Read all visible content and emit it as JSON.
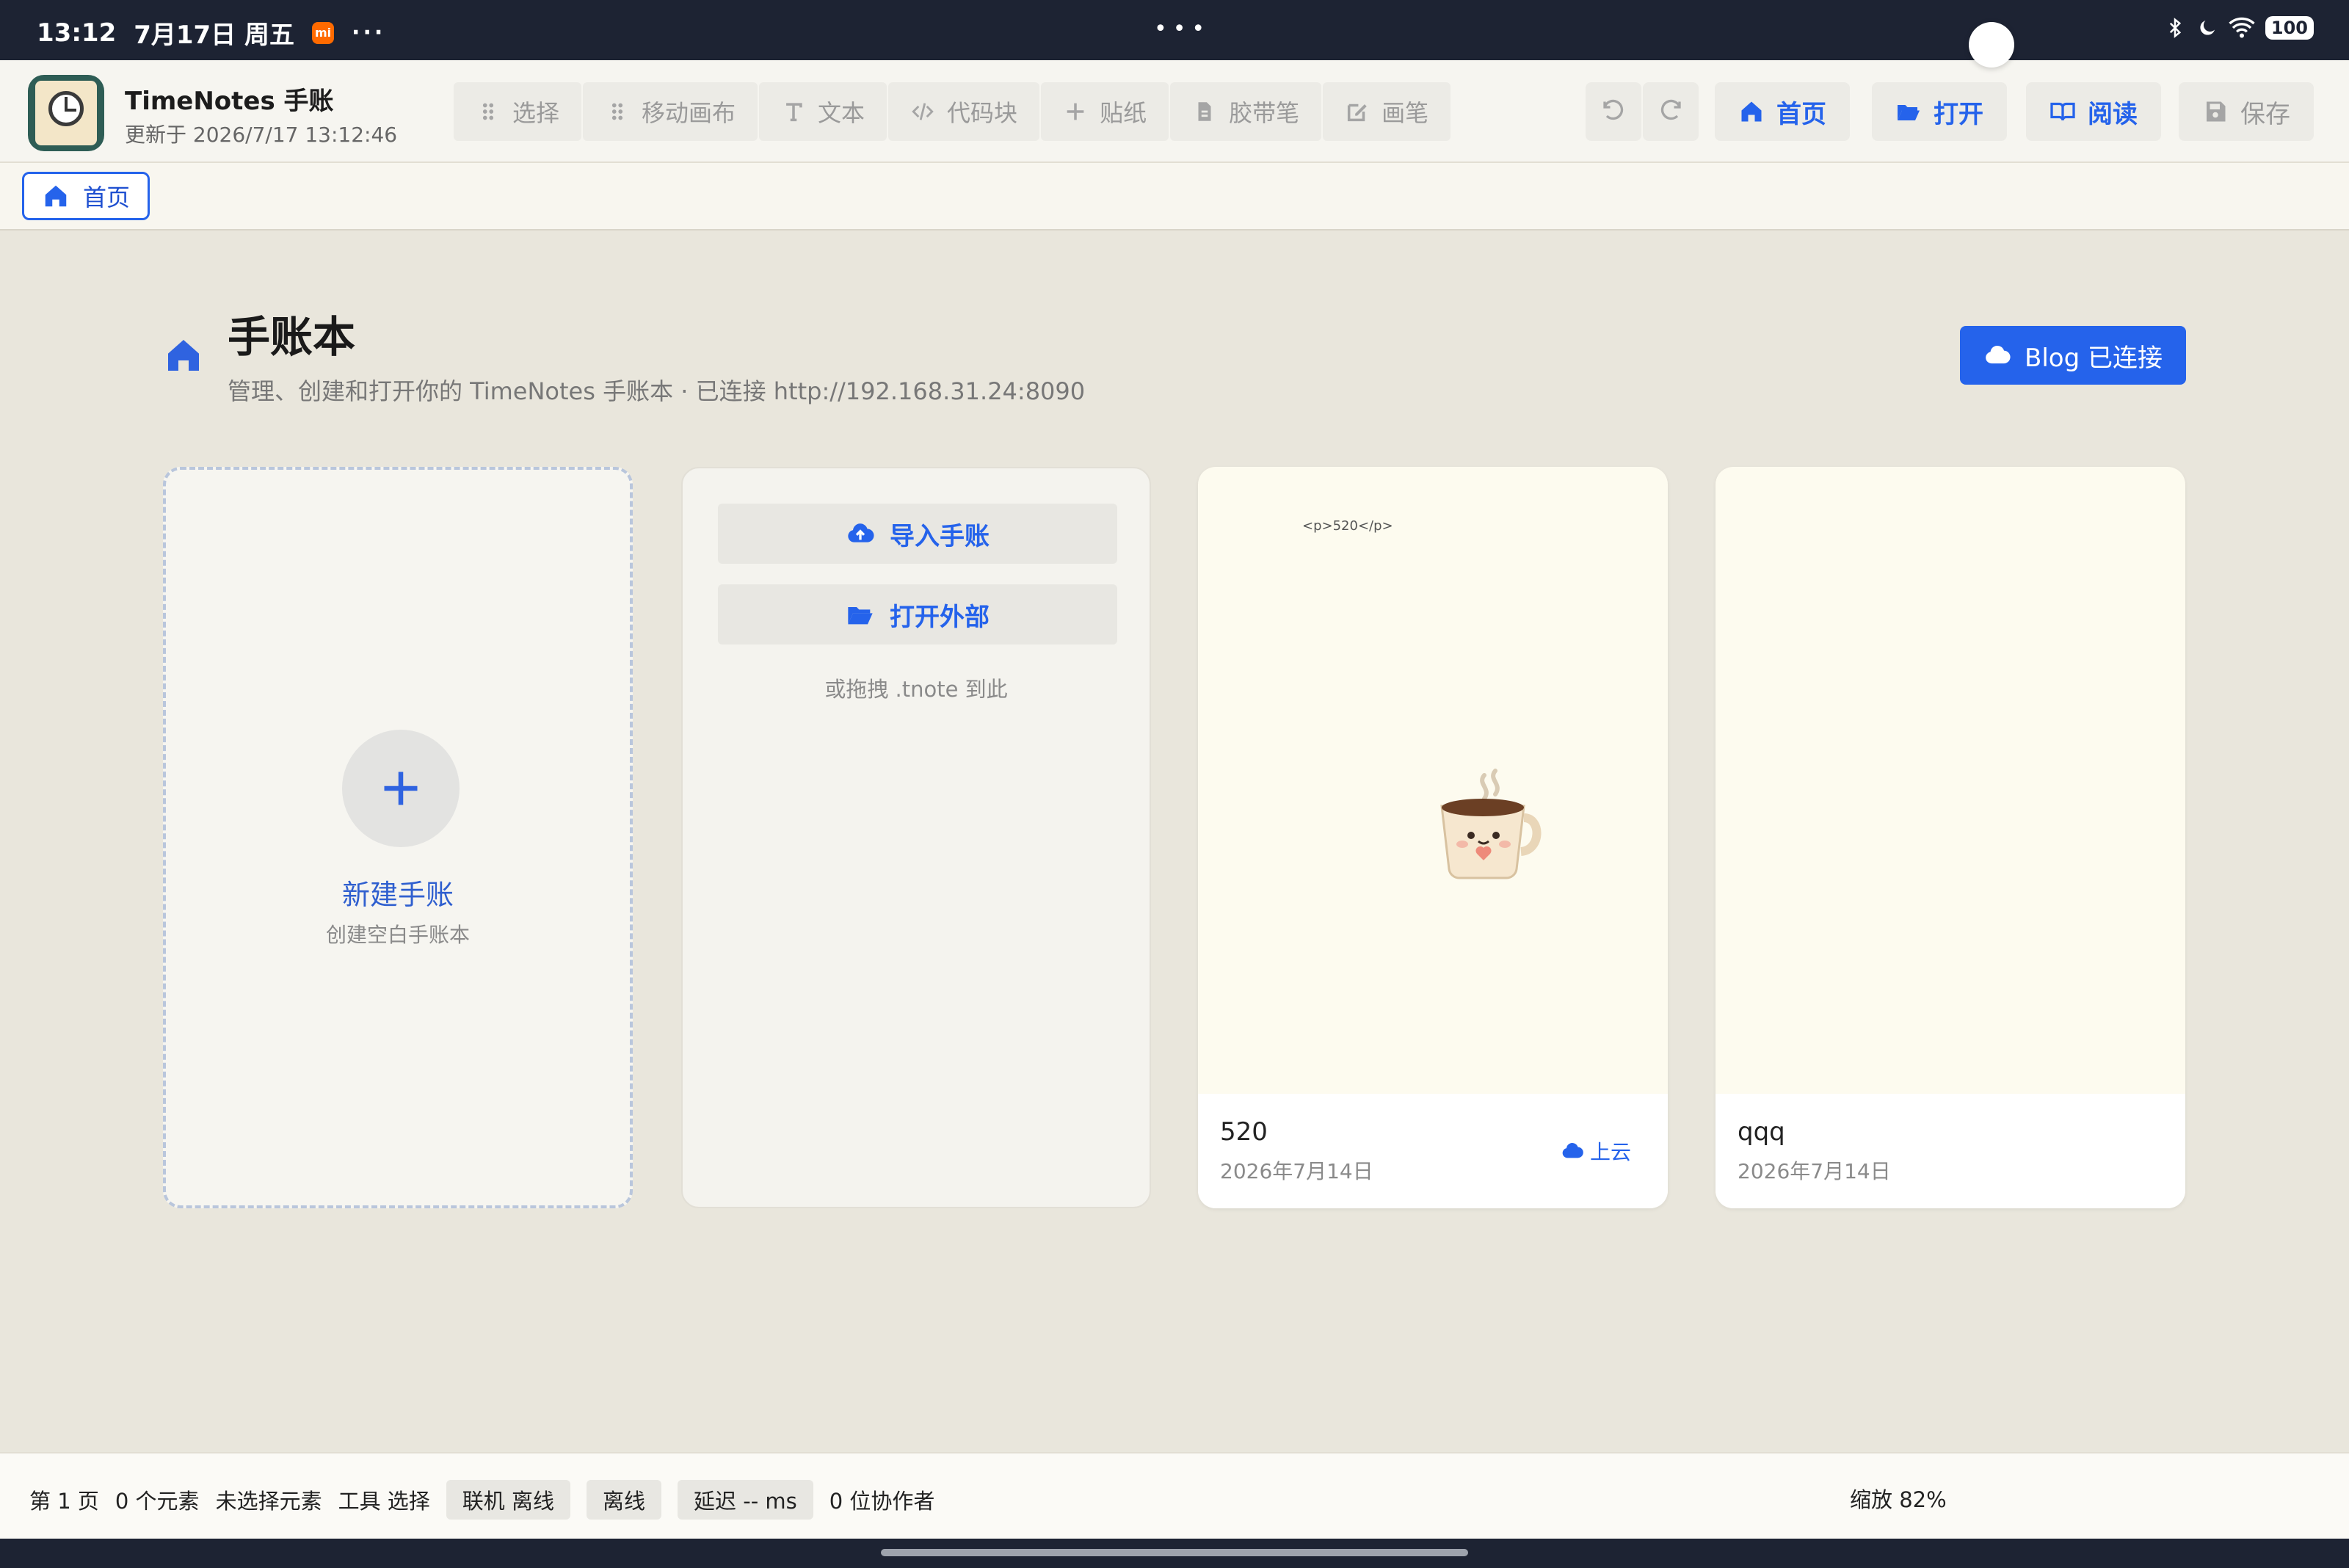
{
  "status_bar": {
    "time": "13:12",
    "date": "7月17日 周五",
    "mi_badge": "mi",
    "more": "···",
    "center_dots": "•••",
    "battery": "100"
  },
  "app": {
    "title": "TimeNotes 手账",
    "updated": "更新于 2026/7/17 13:12:46"
  },
  "toolbar": {
    "tools": [
      {
        "label": "选择",
        "icon": "drag-handle-icon"
      },
      {
        "label": "移动画布",
        "icon": "drag-handle-icon"
      },
      {
        "label": "文本",
        "icon": "text-icon"
      },
      {
        "label": "代码块",
        "icon": "code-icon"
      },
      {
        "label": "贴纸",
        "icon": "plus-icon"
      },
      {
        "label": "胶带笔",
        "icon": "document-icon"
      },
      {
        "label": "画笔",
        "icon": "edit-icon"
      }
    ],
    "home_label": "首页",
    "open_label": "打开",
    "read_label": "阅读",
    "save_label": "保存"
  },
  "tabs": [
    {
      "label": "首页"
    }
  ],
  "main": {
    "title": "手账本",
    "subtitle": "管理、创建和打开你的 TimeNotes 手账本 · 已连接 http://192.168.31.24:8090",
    "blog_button": "Blog 已连接",
    "new_card": {
      "label": "新建手账",
      "sub": "创建空白手账本"
    },
    "import_card": {
      "import_label": "导入手账",
      "open_external_label": "打开外部",
      "hint": "或拖拽 .tnote 到此"
    },
    "notebooks": [
      {
        "name": "520",
        "date": "2026年7月14日",
        "snippet": "<p>520</p>",
        "cloud_label": "上云"
      },
      {
        "name": "qqq",
        "date": "2026年7月14日"
      }
    ]
  },
  "footer": {
    "page": "第 1 页",
    "elements": "0 个元素",
    "selection": "未选择元素",
    "tool": "工具 选择",
    "online": "联机 离线",
    "offline": "离线",
    "latency": "延迟 -- ms",
    "collaborators": "0 位协作者",
    "zoom": "缩放 82%"
  },
  "colors": {
    "accent": "#2563eb",
    "topbar": "#1d2333",
    "background": "#e9e6dc"
  }
}
